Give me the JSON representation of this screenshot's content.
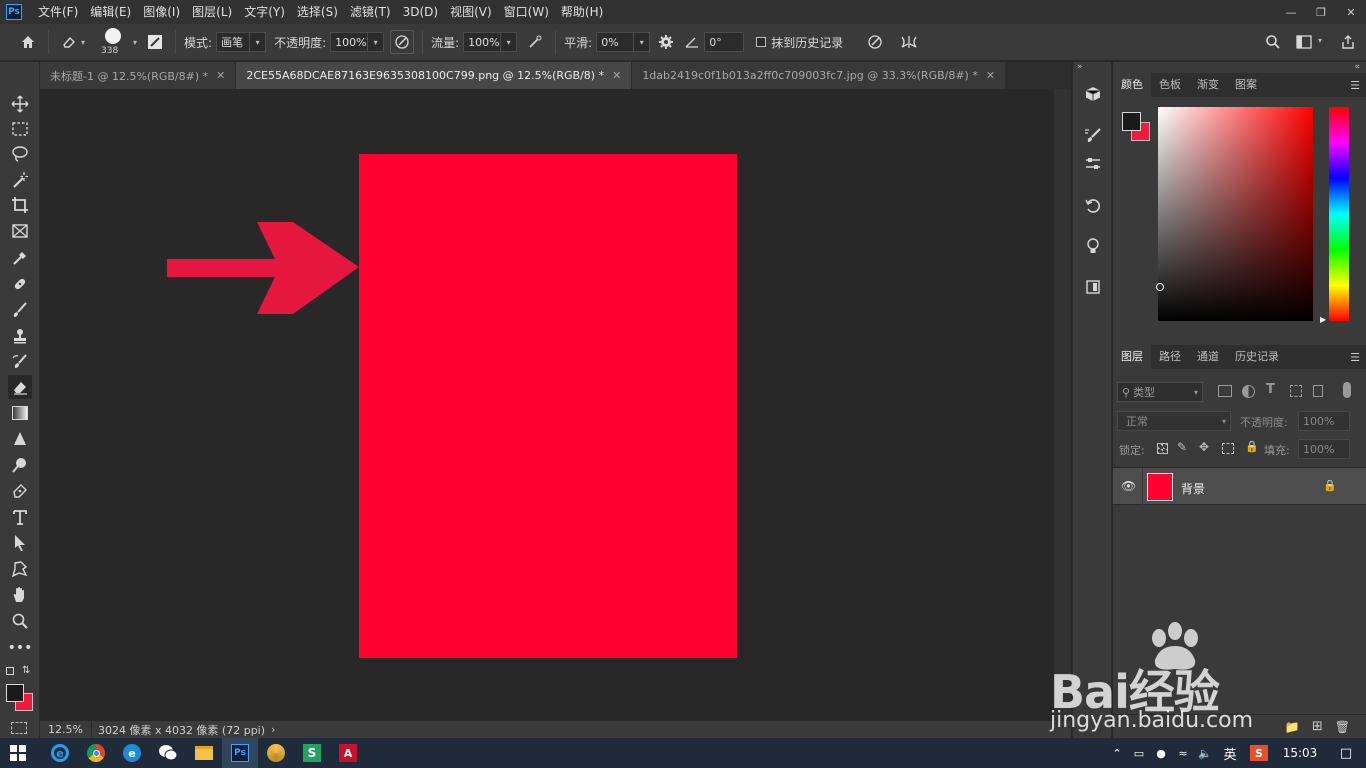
{
  "app": {
    "logo_text": "Ps"
  },
  "menubar": {
    "items": [
      "文件(F)",
      "编辑(E)",
      "图像(I)",
      "图层(L)",
      "文字(Y)",
      "选择(S)",
      "滤镜(T)",
      "3D(D)",
      "视图(V)",
      "窗口(W)",
      "帮助(H)"
    ]
  },
  "options": {
    "brush_size": "338",
    "mode_label": "模式:",
    "mode_value": "画笔",
    "opacity_label": "不透明度:",
    "opacity_value": "100%",
    "flow_label": "流量:",
    "flow_value": "100%",
    "smooth_label": "平滑:",
    "smooth_value": "0%",
    "angle_value": "0°",
    "erase_history_label": "抹到历史记录"
  },
  "tabs": [
    {
      "label": "未标题-1 @ 12.5%(RGB/8#) *"
    },
    {
      "label": "2CE55A68DCAE87163E9635308100C799.png @ 12.5%(RGB/8) *"
    },
    {
      "label": "1dab2419c0f1b013a2ff0c709003fc7.jpg @ 33.3%(RGB/8#) *"
    }
  ],
  "status": {
    "zoom": "12.5%",
    "doc_info": "3024 像素 x 4032 像素 (72 ppi)"
  },
  "colors": {
    "fill": "#ff0030",
    "arrow": "#e5173f",
    "foreground": "#1a1a1a",
    "background": "#ef1a3c"
  },
  "color_panel": {
    "tabs": [
      "颜色",
      "色板",
      "渐变",
      "图案"
    ]
  },
  "layers_panel": {
    "tabs": [
      "图层",
      "路径",
      "通道",
      "历史记录"
    ],
    "filter_label": "类型",
    "blend_mode": "正常",
    "opacity_label": "不透明度:",
    "opacity_value": "100%",
    "lock_label": "锁定:",
    "fill_label": "填充:",
    "fill_value": "100%",
    "layer_name": "背景"
  },
  "watermark": {
    "logo": "Bai经验",
    "url": "jingyan.baidu.com"
  },
  "taskbar": {
    "ime": "英",
    "time": "15:03"
  }
}
